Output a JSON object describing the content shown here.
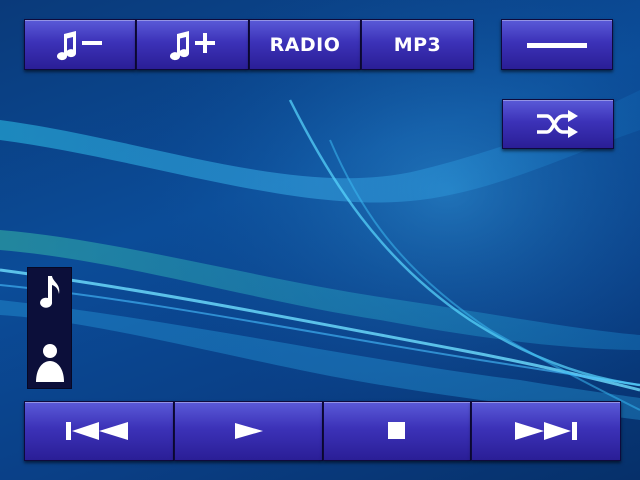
{
  "top_bar": {
    "volume_down": {
      "icon": "music-note-minus-icon"
    },
    "volume_up": {
      "icon": "music-note-plus-icon"
    },
    "radio_label": "RADIO",
    "mp3_label": "MP3",
    "menu": {
      "icon": "menu-dash-icon"
    }
  },
  "shuffle": {
    "icon": "shuffle-icon"
  },
  "side_panel": {
    "items": [
      {
        "icon": "music-note-icon"
      },
      {
        "icon": "user-icon"
      }
    ]
  },
  "transport": {
    "previous": {
      "icon": "previous-track-icon"
    },
    "play": {
      "icon": "play-icon"
    },
    "stop": {
      "icon": "stop-icon"
    },
    "next": {
      "icon": "next-track-icon"
    }
  },
  "colors": {
    "button_top": "#5a5ad8",
    "button_bottom": "#2a1e96",
    "background": "#0b4c98",
    "accent_glow": "#38c8f0",
    "icon": "#ffffff"
  }
}
